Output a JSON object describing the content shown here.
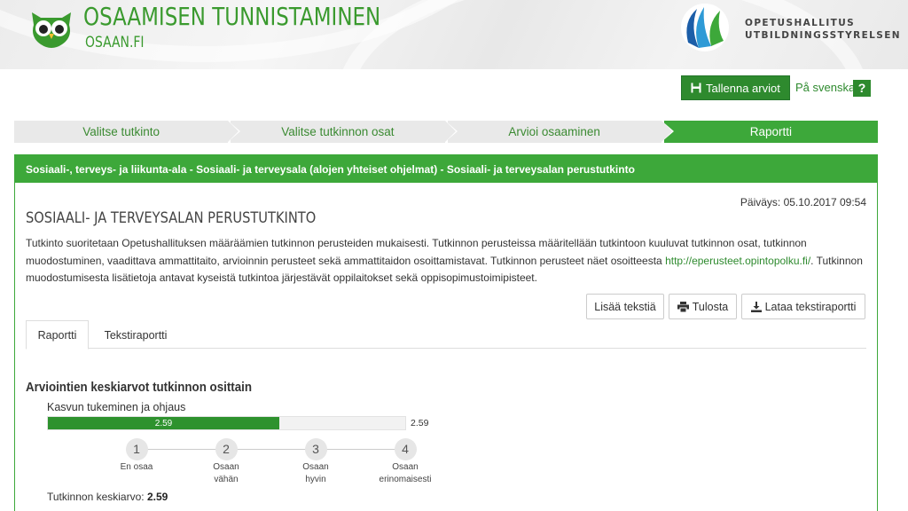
{
  "header": {
    "site_title": "OSAAMISEN TUNNISTAMINEN",
    "site_subtitle": "OSAAN.FI",
    "org_line1": "OPETUSHALLITUS",
    "org_line2": "UTBILDNINGSSTYRELSEN",
    "brand_color": "#3a9a2e"
  },
  "actions": {
    "save_label": "Tallenna arviot",
    "lang_label": "På svenska",
    "help_label": "?"
  },
  "steps": [
    {
      "label": "Valitse tutkinto"
    },
    {
      "label": "Valitse tutkinnon osat"
    },
    {
      "label": "Arvioi osaaminen"
    },
    {
      "label": "Raportti"
    }
  ],
  "panel": {
    "breadcrumb": "Sosiaali-, terveys- ja liikunta-ala - Sosiaali- ja terveysala (alojen yhteiset ohjelmat) - Sosiaali- ja terveysalan perustutkinto",
    "date": "Päiväys: 05.10.2017 09:54",
    "degree_title": "SOSIAALI- JA TERVEYSALAN PERUSTUTKINTO",
    "desc_part1": "Tutkinto suoritetaan Opetushallituksen määräämien tutkinnon perusteiden mukaisesti. Tutkinnon perusteissa määritellään tutkintoon kuuluvat tutkinnon osat, tutkinnon muodostuminen, vaadittava ammattitaito, arvioinnin perusteet sekä ammattitaidon osoittamistavat. Tutkinnon perusteet näet osoitteesta ",
    "desc_link": "http://eperusteet.opintopolku.fi/",
    "desc_part2": ". Tutkinnon muodostumisesta lisätietoja antavat kyseistä tutkintoa järjestävät oppilaitokset sekä oppisopimustoimipisteet.",
    "btn_add_text": "Lisää tekstiä",
    "btn_print": "Tulosta",
    "btn_download": "Lataa tekstiraportti"
  },
  "tabs": [
    {
      "label": "Raportti",
      "active": true
    },
    {
      "label": "Tekstiraportti",
      "active": false
    }
  ],
  "report": {
    "section_title": "Arviointien keskiarvot tutkinnon osittain",
    "units": [
      {
        "name": "Kasvun tukeminen ja ohjaus",
        "value": 2.59,
        "value_label": "2.59",
        "end_label": "2.59"
      }
    ],
    "scale": [
      {
        "num": "1",
        "label_line1": "En osaa",
        "label_line2": ""
      },
      {
        "num": "2",
        "label_line1": "Osaan",
        "label_line2": "vähän"
      },
      {
        "num": "3",
        "label_line1": "Osaan",
        "label_line2": "hyvin"
      },
      {
        "num": "4",
        "label_line1": "Osaan",
        "label_line2": "erinomaisesti"
      }
    ],
    "scale_min": 0,
    "scale_max": 4,
    "avg_label": "Tutkinnon keskiarvo:",
    "avg_value": "2.59"
  }
}
